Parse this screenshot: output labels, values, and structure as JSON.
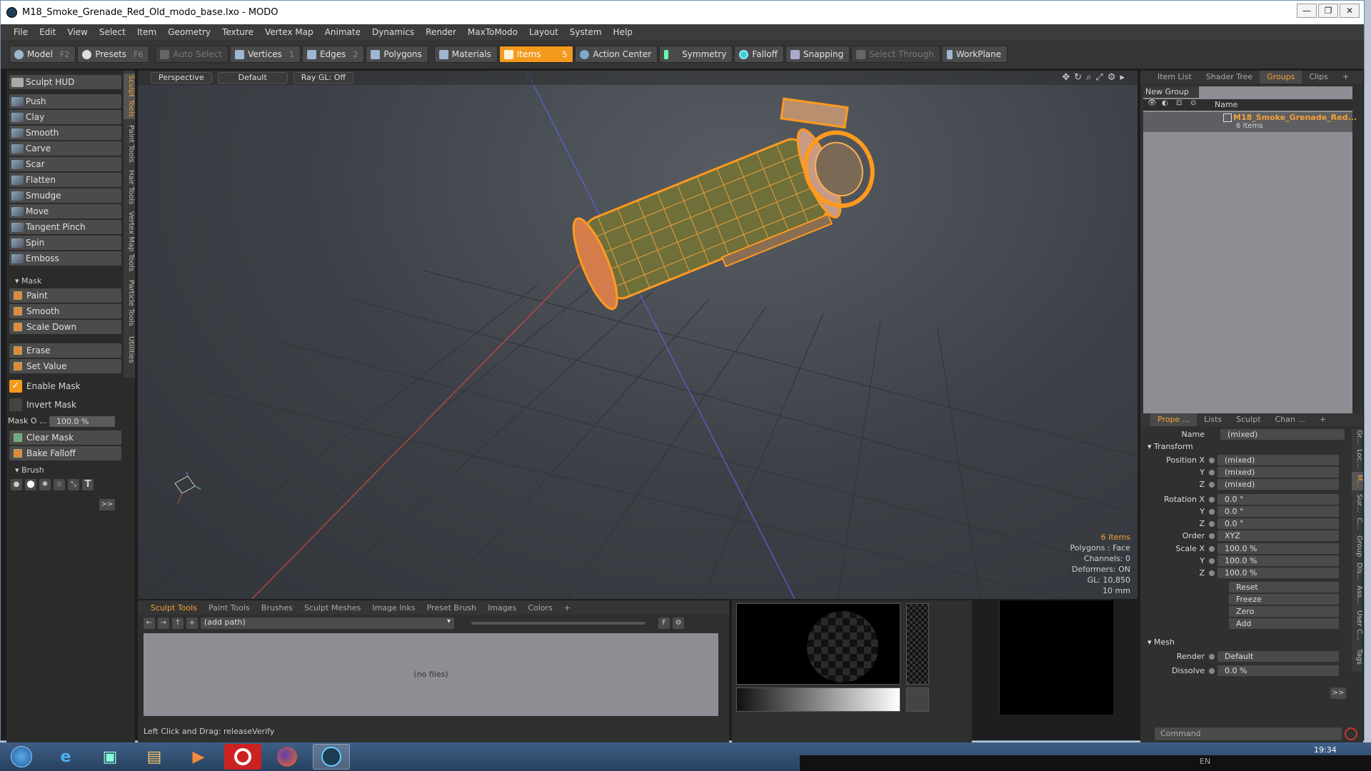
{
  "window": {
    "title": "M18_Smoke_Grenade_Red_Old_modo_base.lxo - MODO",
    "min": "—",
    "max": "❐",
    "close": "✕"
  },
  "menu": [
    "File",
    "Edit",
    "View",
    "Select",
    "Item",
    "Geometry",
    "Texture",
    "Vertex Map",
    "Animate",
    "Dynamics",
    "Render",
    "MaxToModo",
    "Layout",
    "System",
    "Help"
  ],
  "toolbar": {
    "model": "Model",
    "model_key": "F2",
    "presets": "Presets",
    "presets_key": "F6",
    "auto_select": "Auto Select",
    "vertices": "Vertices",
    "vertices_key": "1",
    "edges": "Edges",
    "edges_key": "2",
    "polygons": "Polygons",
    "materials": "Materials",
    "items": "Items",
    "items_key": "5",
    "action_center": "Action Center",
    "symmetry": "Symmetry",
    "falloff": "Falloff",
    "snapping": "Snapping",
    "select_through": "Select Through",
    "workplane": "WorkPlane"
  },
  "left": {
    "hud": "Sculpt HUD",
    "tools": [
      "Push",
      "Clay",
      "Smooth",
      "Carve",
      "Scar",
      "Flatten",
      "Smudge",
      "Move",
      "Tangent Pinch",
      "Spin",
      "Emboss"
    ],
    "mask_header": "Mask",
    "mask_tools": [
      "Paint",
      "Smooth",
      "Scale Down"
    ],
    "erase": "Erase",
    "set_value": "Set Value",
    "enable_mask": "Enable Mask",
    "invert_mask": "Invert Mask",
    "mask_opacity_label": "Mask O ...",
    "mask_opacity_value": "100.0 %",
    "clear_mask": "Clear Mask",
    "bake_falloff": "Bake Falloff",
    "brush_header": "Brush",
    "more": ">>",
    "vtabs": [
      "Sculpt Tools",
      "Paint Tools",
      "Hair Tools",
      "Vertex Map Tools",
      "Particle Tools",
      "Utilities"
    ]
  },
  "viewport": {
    "perspective": "Perspective",
    "shading": "Default",
    "raygl": "Ray GL: Off",
    "info": {
      "items": "6 Items",
      "polygons": "Polygons : Face",
      "channels": "Channels: 0",
      "deformers": "Deformers: ON",
      "gl": "GL: 10,850",
      "unit": "10 mm"
    }
  },
  "bottom": {
    "tabs": [
      "Sculpt Tools",
      "Paint Tools",
      "Brushes",
      "Sculpt Meshes",
      "Image Inks",
      "Preset Brush",
      "Images",
      "Colors",
      "+"
    ],
    "path": "(add path)",
    "f_button": "F",
    "no_files": "(no files)",
    "status": "Left Click and Drag:   releaseVerify"
  },
  "right": {
    "top_tabs": [
      "Item List",
      "Shader Tree",
      "Groups",
      "Clips",
      "+"
    ],
    "new_group": "New Group",
    "name_col": "Name",
    "group_name": "M18_Smoke_Grenade_Red...",
    "group_count": "6 Items",
    "prop_tabs": [
      "Prope ...",
      "Lists",
      "Sculpt",
      "Chan ...",
      "+"
    ],
    "name_label": "Name",
    "name_value": "(mixed)",
    "transform_header": "Transform",
    "position": [
      {
        "label": "Position X",
        "value": "(mixed)"
      },
      {
        "label": "Y",
        "value": "(mixed)"
      },
      {
        "label": "Z",
        "value": "(mixed)"
      }
    ],
    "rotation": [
      {
        "label": "Rotation X",
        "value": "0.0 °"
      },
      {
        "label": "Y",
        "value": "0.0 °"
      },
      {
        "label": "Z",
        "value": "0.0 °"
      }
    ],
    "order_label": "Order",
    "order_value": "XYZ",
    "scale": [
      {
        "label": "Scale X",
        "value": "100.0 %"
      },
      {
        "label": "Y",
        "value": "100.0 %"
      },
      {
        "label": "Z",
        "value": "100.0 %"
      }
    ],
    "actions": [
      "Reset",
      "Freeze",
      "Zero",
      "Add"
    ],
    "mesh_header": "Mesh",
    "render_label": "Render",
    "render_value": "Default",
    "dissolve_label": "Dissolve",
    "dissolve_value": "0.0 %",
    "more": ">>",
    "side_tabs": [
      "Gr...",
      "Loc...",
      "M...",
      "Sur...",
      "C...",
      "Group",
      "Dis...",
      "Ass...",
      "User C...",
      "Tags"
    ],
    "command": "Command"
  },
  "taskbar": {
    "clock": "19:34",
    "lang": "EN"
  },
  "colors": {
    "accent": "#f39a1c",
    "panel": "#2b2b2b",
    "viewport": "#3d4147"
  }
}
